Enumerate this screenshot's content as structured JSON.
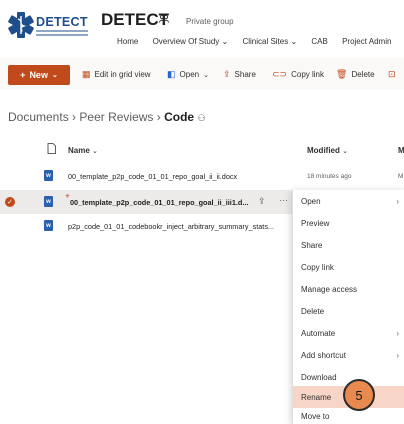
{
  "header": {
    "logo_text": "DETECT",
    "site_title": "DETECT",
    "group_label": "Private group",
    "nav": [
      "Home",
      "Overview Of Study ⌄",
      "Clinical Sites ⌄",
      "CAB",
      "Project Admin"
    ]
  },
  "toolbar": {
    "new_label": "New",
    "items": [
      "Edit in grid view",
      "Open",
      "Share",
      "Copy link",
      "Delete"
    ]
  },
  "breadcrumb": {
    "root": "Documents",
    "mid": "Peer Reviews",
    "current": "Code"
  },
  "list": {
    "col_name": "Name",
    "col_modified": "Modified",
    "col_modby": "M",
    "rows": [
      {
        "name": "00_template_p2p_code_01_01_repo_goal_ii_ii.docx",
        "modified": "18 minutes ago",
        "modby": "M",
        "selected": false
      },
      {
        "name": "00_template_p2p_code_01_01_repo_goal_ii_iii1.d...",
        "modified": "",
        "modby": "",
        "selected": true
      },
      {
        "name": "p2p_code_01_01_codebookr_inject_arbitrary_summary_stats...",
        "modified": "",
        "modby": "",
        "selected": false
      }
    ]
  },
  "context_menu": {
    "items": [
      {
        "label": "Open",
        "submenu": true
      },
      {
        "label": "Preview",
        "submenu": false
      },
      {
        "label": "Share",
        "submenu": false
      },
      {
        "label": "Copy link",
        "submenu": false
      },
      {
        "label": "Manage access",
        "submenu": false
      },
      {
        "label": "Delete",
        "submenu": false
      },
      {
        "label": "Automate",
        "submenu": true
      },
      {
        "label": "Add shortcut",
        "submenu": true
      },
      {
        "label": "Download",
        "submenu": false
      },
      {
        "label": "Rename",
        "submenu": false,
        "highlighted": true
      },
      {
        "label": "Move to",
        "submenu": false
      }
    ],
    "step_marker": "5"
  },
  "colors": {
    "accent": "#c14a1c",
    "menu_highlight": "#f7d6c7",
    "marker": "#e8894f",
    "brand": "#1f4e8c"
  }
}
